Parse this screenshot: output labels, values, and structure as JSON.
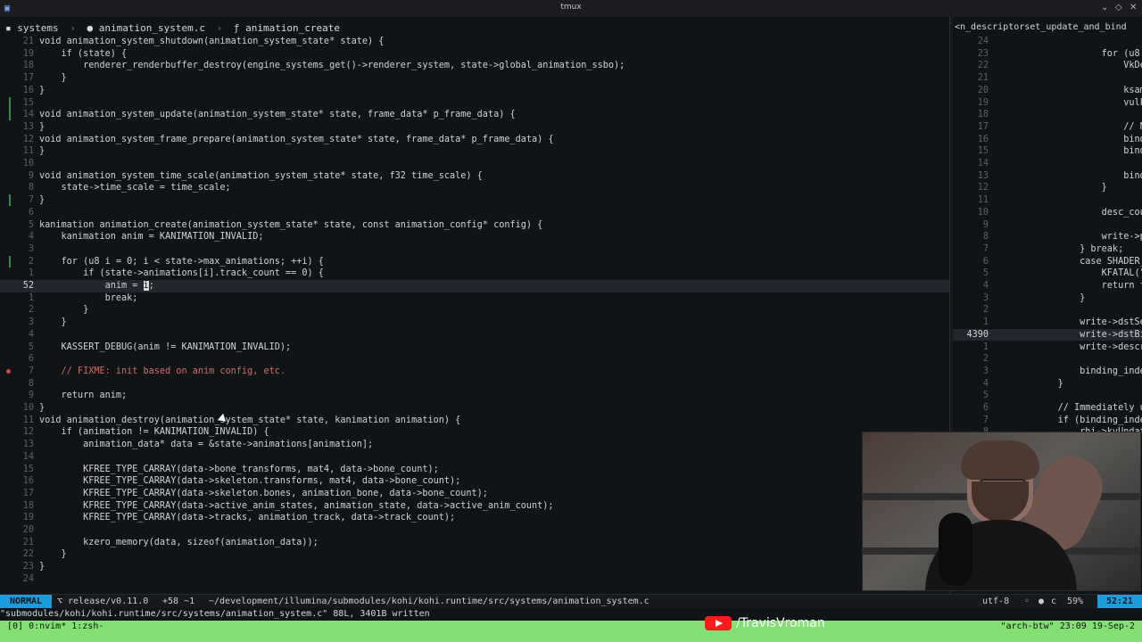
{
  "window": {
    "title": "tmux",
    "app_icon": "terminal-icon"
  },
  "breadcrumb": [
    {
      "icon": "folder-icon",
      "label": "systems"
    },
    {
      "icon": "file-icon",
      "label": "animation_system.c"
    },
    {
      "icon": "function-icon",
      "label": "animation_create"
    }
  ],
  "left_code": [
    {
      "no": "21",
      "text": "void animation_system_shutdown(animation_system_state* state) {"
    },
    {
      "no": "19",
      "text": "    if (state) {"
    },
    {
      "no": "18",
      "text": "        renderer_renderbuffer_destroy(engine_systems_get()->renderer_system, state->global_animation_ssbo);"
    },
    {
      "no": "17",
      "text": "    }"
    },
    {
      "no": "16",
      "text": "}"
    },
    {
      "no": "15",
      "text": ""
    },
    {
      "no": "14",
      "text": "void animation_system_update(animation_system_state* state, frame_data* p_frame_data) {"
    },
    {
      "no": "13",
      "text": "}"
    },
    {
      "no": "12",
      "text": "void animation_system_frame_prepare(animation_system_state* state, frame_data* p_frame_data) {"
    },
    {
      "no": "11",
      "text": "}"
    },
    {
      "no": "10",
      "text": ""
    },
    {
      "no": "9",
      "text": "void animation_system_time_scale(animation_system_state* state, f32 time_scale) {"
    },
    {
      "no": "8",
      "text": "    state->time_scale = time_scale;"
    },
    {
      "no": "7",
      "text": "}"
    },
    {
      "no": "6",
      "text": ""
    },
    {
      "no": "5",
      "text": "kanimation animation_create(animation_system_state* state, const animation_config* config) {"
    },
    {
      "no": "4",
      "text": "    kanimation anim = KANIMATION_INVALID;"
    },
    {
      "no": "3",
      "text": ""
    },
    {
      "no": "2",
      "text": "    for (u8 i = 0; i < state->max_animations; ++i) {"
    },
    {
      "no": "1",
      "text": "        if (state->animations[i].track_count == 0) {"
    },
    {
      "no": "52",
      "text": "            anim = i;"
    },
    {
      "no": "1",
      "text": "            break;"
    },
    {
      "no": "2",
      "text": "        }"
    },
    {
      "no": "3",
      "text": "    }"
    },
    {
      "no": "4",
      "text": ""
    },
    {
      "no": "5",
      "text": "    KASSERT_DEBUG(anim != KANIMATION_INVALID);"
    },
    {
      "no": "6",
      "text": ""
    },
    {
      "no": "7",
      "text": "    // FIXME: init based on anim config, etc."
    },
    {
      "no": "8",
      "text": ""
    },
    {
      "no": "9",
      "text": "    return anim;"
    },
    {
      "no": "10",
      "text": "}"
    },
    {
      "no": "11",
      "text": "void animation_destroy(animation_system_state* state, kanimation animation) {"
    },
    {
      "no": "12",
      "text": "    if (animation != KANIMATION_INVALID) {"
    },
    {
      "no": "13",
      "text": "        animation_data* data = &state->animations[animation];"
    },
    {
      "no": "14",
      "text": ""
    },
    {
      "no": "15",
      "text": "        KFREE_TYPE_CARRAY(data->bone_transforms, mat4, data->bone_count);"
    },
    {
      "no": "16",
      "text": "        KFREE_TYPE_CARRAY(data->skeleton.transforms, mat4, data->bone_count);"
    },
    {
      "no": "17",
      "text": "        KFREE_TYPE_CARRAY(data->skeleton.bones, animation_bone, data->bone_count);"
    },
    {
      "no": "18",
      "text": "        KFREE_TYPE_CARRAY(data->active_anim_states, animation_state, data->active_anim_count);"
    },
    {
      "no": "19",
      "text": "        KFREE_TYPE_CARRAY(data->tracks, animation_track, data->track_count);"
    },
    {
      "no": "20",
      "text": ""
    },
    {
      "no": "21",
      "text": "        kzero_memory(data, sizeof(animation_data));"
    },
    {
      "no": "22",
      "text": "    }"
    },
    {
      "no": "23",
      "text": "}"
    },
    {
      "no": "24",
      "text": ""
    }
  ],
  "right_title": "<n_descriptorset_update_and_bind",
  "right_code": [
    {
      "no": "24",
      "text": ""
    },
    {
      "no": "23",
      "text": "                    for (u8 s"
    },
    {
      "no": "22",
      "text": "                        VkDes"
    },
    {
      "no": "21",
      "text": ""
    },
    {
      "no": "20",
      "text": "                        ksamp"
    },
    {
      "no": "19",
      "text": "                        vulka"
    },
    {
      "no": "18",
      "text": ""
    },
    {
      "no": "17",
      "text": "                        // NO"
    },
    {
      "no": "16",
      "text": "                        bindi"
    },
    {
      "no": "15",
      "text": "                        bindi"
    },
    {
      "no": "14",
      "text": ""
    },
    {
      "no": "13",
      "text": "                        bindi"
    },
    {
      "no": "12",
      "text": "                    }"
    },
    {
      "no": "11",
      "text": ""
    },
    {
      "no": "10",
      "text": "                    desc_coun"
    },
    {
      "no": "9",
      "text": ""
    },
    {
      "no": "8",
      "text": "                    write->pI"
    },
    {
      "no": "7",
      "text": "                } break;"
    },
    {
      "no": "6",
      "text": "                case SHADER_B"
    },
    {
      "no": "5",
      "text": "                    KFATAL(\"W"
    },
    {
      "no": "4",
      "text": "                    return fa"
    },
    {
      "no": "3",
      "text": "                }"
    },
    {
      "no": "2",
      "text": ""
    },
    {
      "no": "1",
      "text": "                write->dstSet"
    },
    {
      "no": "4390",
      "text": "                write->dstBin"
    },
    {
      "no": "1",
      "text": "                write->descri"
    },
    {
      "no": "2",
      "text": ""
    },
    {
      "no": "3",
      "text": "                binding_index"
    },
    {
      "no": "4",
      "text": "            }"
    },
    {
      "no": "5",
      "text": ""
    },
    {
      "no": "6",
      "text": "            // Immediately up"
    },
    {
      "no": "7",
      "text": "            if (binding_index"
    },
    {
      "no": "8",
      "text": "                rhi->kvUndat"
    }
  ],
  "status": {
    "mode": "NORMAL",
    "branch": "release/v0.11.0",
    "diff": "+58 ~1",
    "path": "~/development/illumina/submodules/kohi/kohi.runtime/src/systems/animation_system.c",
    "encoding": "utf-8",
    "lang": "c",
    "percent": "59%",
    "cursor": "52:21"
  },
  "cmdline": "\"submodules/kohi/kohi.runtime/src/systems/animation_system.c\" 88L, 3401B written",
  "tmux": {
    "left": "[0] 0:nvim* 1:zsh-",
    "right": "\"arch-btw\" 23:09 19-Sep-2"
  },
  "youtube": {
    "label": "/TravisVroman",
    "icon": "youtube-icon"
  }
}
